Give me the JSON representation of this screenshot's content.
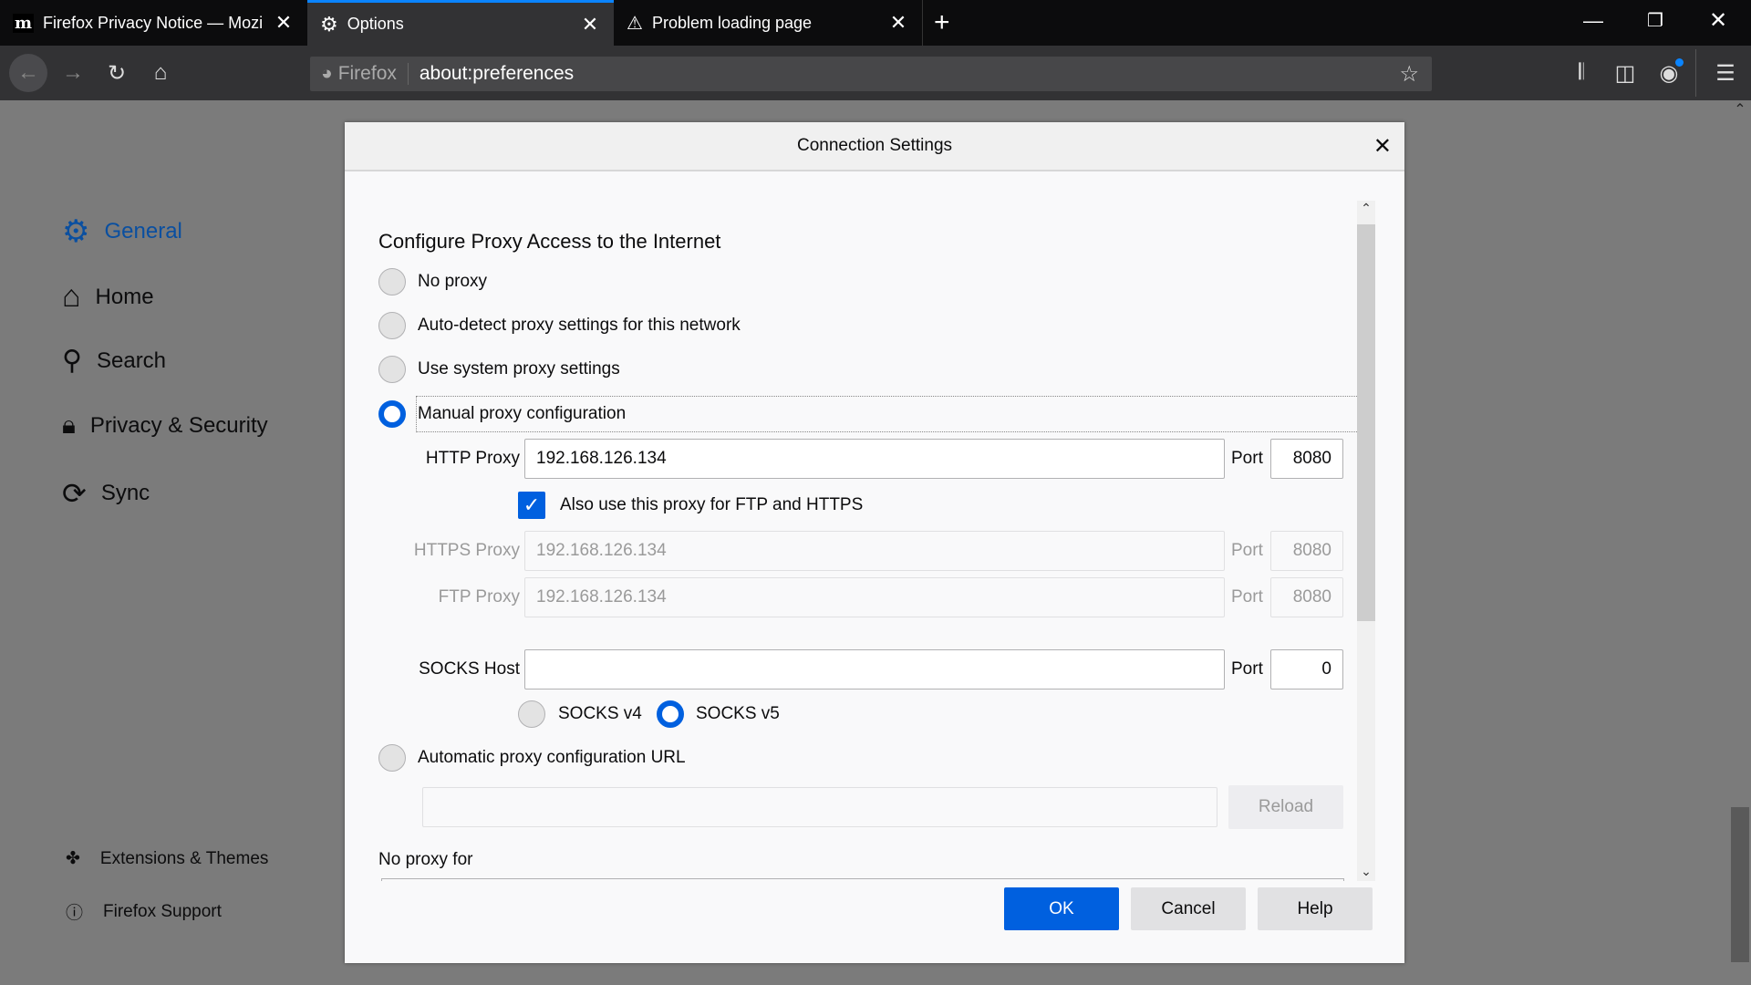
{
  "tabs": [
    {
      "label": "Firefox Privacy Notice — Mozilla",
      "icon": "mozilla-logo-icon"
    },
    {
      "label": "Options",
      "icon": "gear-icon",
      "active": true
    },
    {
      "label": "Problem loading page",
      "icon": "warning-icon"
    }
  ],
  "urlbar": {
    "identity": "Firefox",
    "url": "about:preferences"
  },
  "sidebar": {
    "items": [
      {
        "label": "General",
        "icon": "gear-icon",
        "active": true
      },
      {
        "label": "Home",
        "icon": "home-icon"
      },
      {
        "label": "Search",
        "icon": "search-icon"
      },
      {
        "label": "Privacy & Security",
        "icon": "lock-icon"
      },
      {
        "label": "Sync",
        "icon": "sync-icon"
      }
    ],
    "footer": [
      {
        "label": "Extensions & Themes",
        "icon": "puzzle-icon"
      },
      {
        "label": "Firefox Support",
        "icon": "help-circle-icon"
      }
    ]
  },
  "dialog": {
    "title": "Connection Settings",
    "heading": "Configure Proxy Access to the Internet",
    "options": {
      "no_proxy": "No proxy",
      "auto_detect": "Auto-detect proxy settings for this network",
      "system": "Use system proxy settings",
      "manual": "Manual proxy configuration",
      "auto_url": "Automatic proxy configuration URL"
    },
    "selected": "manual",
    "http": {
      "label": "HTTP Proxy",
      "value": "192.168.126.134",
      "port_label": "Port",
      "port": "8080"
    },
    "also_use": {
      "label": "Also use this proxy for FTP and HTTPS",
      "checked": true
    },
    "https": {
      "label": "HTTPS Proxy",
      "value": "192.168.126.134",
      "port_label": "Port",
      "port": "8080"
    },
    "ftp": {
      "label": "FTP Proxy",
      "value": "192.168.126.134",
      "port_label": "Port",
      "port": "8080"
    },
    "socks": {
      "label": "SOCKS Host",
      "value": "",
      "port_label": "Port",
      "port": "0",
      "v4": "SOCKS v4",
      "v5": "SOCKS v5",
      "selected": "v5"
    },
    "auto_url_value": "",
    "reload": "Reload",
    "no_proxy_for": "No proxy for",
    "buttons": {
      "ok": "OK",
      "cancel": "Cancel",
      "help": "Help"
    }
  },
  "colors": {
    "accent": "#0060df",
    "tab_highlight": "#0a84ff",
    "sidebar_active": "#0a4fa0"
  }
}
